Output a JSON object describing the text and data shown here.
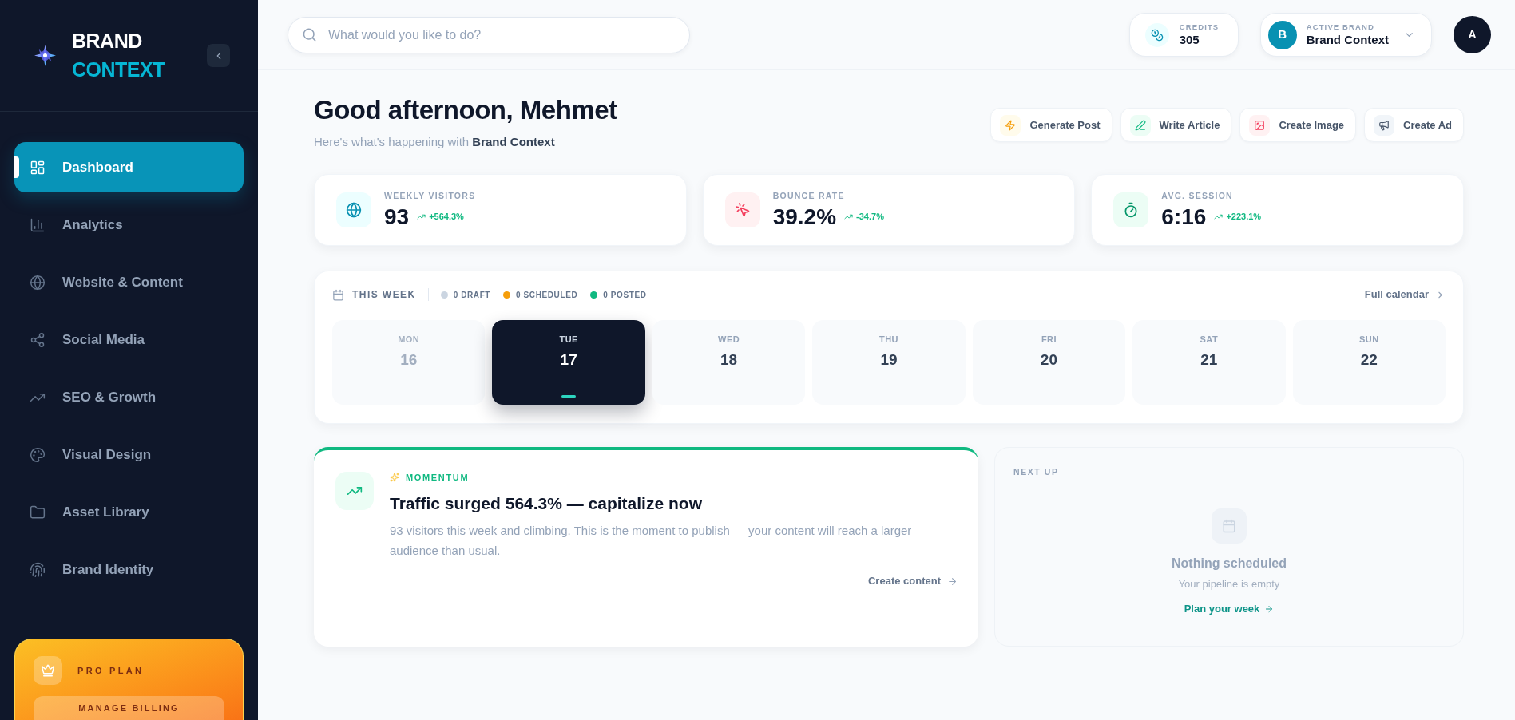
{
  "sidebar": {
    "logo": [
      "BRAND",
      "CONTEXT"
    ],
    "items": [
      {
        "label": "Dashboard",
        "selected": true
      },
      {
        "label": "Analytics",
        "selected": false
      },
      {
        "label": "Website & Content",
        "selected": false
      },
      {
        "label": "Social Media",
        "selected": false
      },
      {
        "label": "SEO & Growth",
        "selected": false
      },
      {
        "label": "Visual Design",
        "selected": false
      },
      {
        "label": "Asset Library",
        "selected": false
      },
      {
        "label": "Brand Identity",
        "selected": false
      }
    ],
    "plan": {
      "label": "PRO PLAN",
      "button": "MANAGE BILLING"
    }
  },
  "topbar": {
    "search": {
      "placeholder": "What would you like to do?"
    },
    "credits": {
      "label": "CREDITS",
      "value": "305"
    },
    "brand": {
      "initial": "B",
      "label": "ACTIVE BRAND",
      "name": "Brand Context"
    },
    "avatar": "A"
  },
  "header": {
    "title": "Good afternoon, Mehmet",
    "subtitle": "Here's what's happening with **Brand Context**"
  },
  "quick_actions": [
    "Generate Post",
    "Write Article",
    "Create Image",
    "Create Ad"
  ],
  "stats": [
    {
      "label": "WEEKLY VISITORS",
      "value": "93",
      "change": "+564.3%"
    },
    {
      "label": "BOUNCE RATE",
      "value": "39.2%",
      "change": "-34.7%"
    },
    {
      "label": "AVG. SESSION",
      "value": "6:16",
      "change": "+223.1%"
    }
  ],
  "week": {
    "title": "THIS WEEK",
    "legend": [
      {
        "label": "0 DRAFT",
        "color": "#cbd5e1"
      },
      {
        "label": "0 SCHEDULED",
        "color": "#f59e0b"
      },
      {
        "label": "0 POSTED",
        "color": "#10b981"
      }
    ],
    "link": "Full calendar",
    "days": [
      {
        "day": "MON",
        "date": "16",
        "past": true,
        "selected": false
      },
      {
        "day": "TUE",
        "date": "17",
        "past": false,
        "selected": true
      },
      {
        "day": "WED",
        "date": "18",
        "past": false,
        "selected": false
      },
      {
        "day": "THU",
        "date": "19",
        "past": false,
        "selected": false
      },
      {
        "day": "FRI",
        "date": "20",
        "past": false,
        "selected": false
      },
      {
        "day": "SAT",
        "date": "21",
        "past": false,
        "selected": false
      },
      {
        "day": "SUN",
        "date": "22",
        "past": false,
        "selected": false
      }
    ]
  },
  "momentum": {
    "tag": "MOMENTUM",
    "title": "Traffic surged 564.3% — capitalize now",
    "text": "93 visitors this week and climbing. This is the moment to publish — your content will reach a larger audience than usual.",
    "link": "Create content"
  },
  "next_up": {
    "title": "NEXT UP",
    "empty_title": "Nothing scheduled",
    "empty_text": "Your pipeline is empty",
    "link": "Plan your week"
  }
}
